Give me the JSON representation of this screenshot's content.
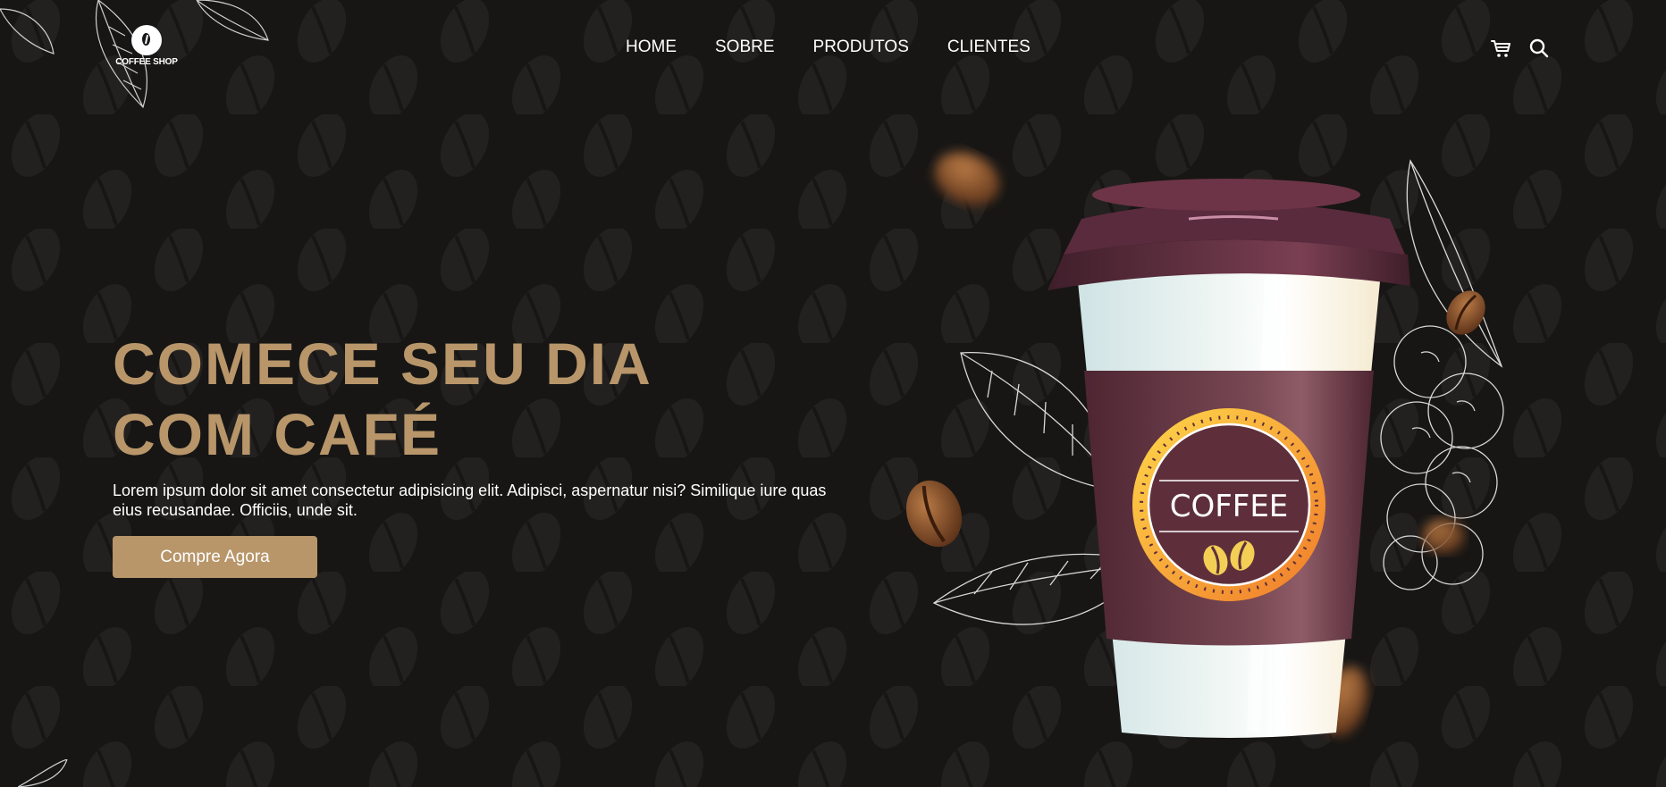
{
  "brand": {
    "logo_text": "COFFEE SHOP",
    "icon": "coffee-bean-icon"
  },
  "nav": {
    "items": [
      {
        "label": "HOME"
      },
      {
        "label": "SOBRE"
      },
      {
        "label": "PRODUTOS"
      },
      {
        "label": "CLIENTES"
      }
    ]
  },
  "header_icons": {
    "cart": "cart-icon",
    "search": "search-icon"
  },
  "hero": {
    "title_line1": "COMECE SEU DIA",
    "title_line2": "COM CAFÉ",
    "description": "Lorem ipsum dolor sit amet consectetur adipisicing elit. Adipisci, aspernatur nisi? Similique iure quas eius recusandae. Officiis, unde sit.",
    "cta_label": "Compre Agora"
  },
  "cup": {
    "label": "COFFEE"
  },
  "colors": {
    "background": "#171615",
    "accent": "#b8966a",
    "text": "#ffffff",
    "cup_sleeve": "#5e2f3b",
    "cup_lid": "#4a2431",
    "badge_ring": "#f2b33a"
  }
}
